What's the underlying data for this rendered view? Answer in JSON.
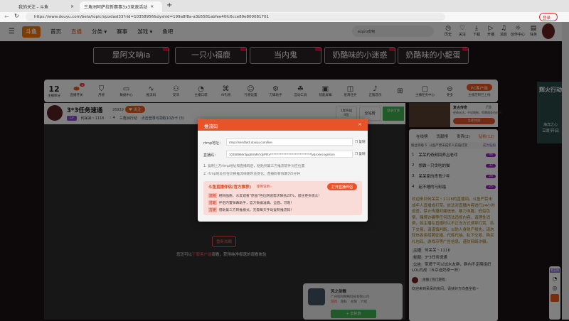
{
  "browser": {
    "tabs": [
      {
        "label": "我的关注 - 斗鱼"
      },
      {
        "label": "三角洲阿萨拉新赛事3x3竞速活动"
      }
    ],
    "new_tab": "+",
    "url": "https://www.douyu.com/beta/topic/sjzxdasl33?rid=10358956&dyshid=199a8f8a-a3b5581abfee40fc6cce89e800081701",
    "login": "登录"
  },
  "nav": {
    "logo": "斗鱼",
    "items": [
      "首页",
      "直播",
      "分类 ▾",
      "赛事",
      "游戏 ▾",
      "鱼吧"
    ],
    "active": 1,
    "search_placeholder": "expro皮物",
    "icons": [
      {
        "icon": "history-icon",
        "label": "历史"
      },
      {
        "icon": "heart-icon",
        "label": "关注"
      },
      {
        "icon": "download-icon",
        "label": "下载"
      },
      {
        "icon": "broadcast-icon",
        "label": "开播"
      },
      {
        "icon": "bell-icon",
        "label": "消息"
      },
      {
        "icon": "bulb-icon",
        "label": "创作中心"
      },
      {
        "icon": "task-icon",
        "label": "任务"
      }
    ]
  },
  "names": [
    "是阿文呐ia",
    "一只小福鹿",
    "当内鬼",
    "奶酪味的小迷惑",
    "奶酪味的小龍蛋"
  ],
  "toolbar": {
    "score": "12",
    "score_label": "主播积分",
    "items": [
      "直播开关",
      "月榜",
      "数据中心",
      "推流码",
      "友邻",
      "主播口袋",
      "AI礼物",
      "礼物设置",
      "刀锋助手",
      "互动工具",
      "智能屏幕",
      "星海任务",
      "正版音乐",
      "",
      "主播任务中心",
      "更多"
    ],
    "switch_badge": "1",
    "pc_client": "PC客户端",
    "pc_sub": "主播定制已上线"
  },
  "streamer": {
    "title": "3*3任务速通",
    "hot": "26939",
    "follow": "关注",
    "level": "",
    "name": "何呆呆丶1116",
    "likes": "4",
    "category": "三角洲行动",
    "tip": "点击登录可领取10办卡 (3)",
    "rank_btn": "1屋热战",
    "rank_val": "0位",
    "all_rank": "全站榜",
    "gift": "登录可领"
  },
  "video": {
    "reload": "重新加载",
    "hint_pre": "您还可以",
    "hint_link": "下载客户端",
    "hint_post": "观看，获得纯净极速的观看体验"
  },
  "game_ad": {
    "title": "风之剑舞",
    "company": "广州指阿网络科技有限公司",
    "tags": [
      "游戏",
      "隐私",
      "权限",
      "介绍"
    ],
    "button": "+ 去好游"
  },
  "right_ad": {
    "title": "复古传奇",
    "desc": "经典玩法，不设限制，您需随身仿价关",
    "button": "立即体验",
    "tag": "广告"
  },
  "rank": {
    "tabs": [
      "在线榜",
      "贡献榜",
      "贵宾(2)",
      "钻粉(12)"
    ],
    "fan_level": "粉丝等级 5",
    "fan_hint": "斗鱼严禁未成年人充值打赏",
    "become": "成为钻粉",
    "rows": [
      {
        "n": "1",
        "name": "呆呆的奇颜回养吕老邓",
        "lvl": "46"
      },
      {
        "n": "2",
        "name": "想做一只贪吃的猫",
        "lvl": "32"
      },
      {
        "n": "3",
        "name": "呆呆家的青青少年",
        "lvl": "26"
      },
      {
        "n": "4",
        "name": "起不睡的马彩福",
        "lvl": "25"
      }
    ],
    "notice": "欢迎来到何呆呆丶1116的直播间。斗鱼严禁未成年人直播或打赏。依法对直播内容进行24小时巡查，禁止传播封建迷信、暴力血腥、低俗色情、赌博诈骗等任何违法违规内容。请理性消费，如主播在直播时以不正当方式诱导打赏、私下交易，请谨慎判断，以防人身财产损失。请勿轻信各类招聘征婚、代练代抽、私下交易、购买礼包码、游戏币等广告信息，谨防网络诈骗。",
    "info": [
      {
        "k": "主播",
        "v": "何呆呆丶1116"
      },
      {
        "k": "标题",
        "v": "3*3任务速通"
      },
      {
        "k": "公告",
        "v": "带牌子可以加水友群，群内不定期组织LOL内战（五杀送奶茶一杯）"
      }
    ],
    "chat_user_tag": "主播",
    "chat_user_badge": "热门游戏",
    "chat_msg": "欢迎来到呆呆的房间，请扶好方向盘坐稳~"
  },
  "far_ad": {
    "title": "辉火行动",
    "sub": "海洋之心",
    "button": "立即开启"
  },
  "side": {
    "label": "看直播"
  },
  "modal": {
    "title": "推流码",
    "close": "×",
    "rtmp_label": "rtmp地址：",
    "rtmp_value": "rtmp://sendtw3.douyu.com/live",
    "code_label": "直播码：",
    "code_value": "10358956r3jqq5XM6?dyPRx*********************************lv&roirecognition",
    "copy": "复制",
    "note1": "1. 复制上方rtmp地址和直播码后，粘贴到第三方推流软件对应位置",
    "note2": "2. rtmp地址仅在切换推流线路时会变化；直播码有效期为5分钟",
    "promo_title": "斗鱼直播伴侣(官方推荐)",
    "promo_link": "使用说明 ›",
    "open": "打开直播伴侣",
    "promo": [
      {
        "tag": "流畅",
        "text": "相同画质、水友观看\"原画\"档位网速需求降低20%，留住更多观众！"
      },
      {
        "tag": "可靠",
        "text": "伴侣内置弹幕助手，官方数据准确、全面、可靠！"
      },
      {
        "tag": "方便",
        "text": "借助第三方转推模式，无需每天手动复制推流码！"
      }
    ]
  }
}
